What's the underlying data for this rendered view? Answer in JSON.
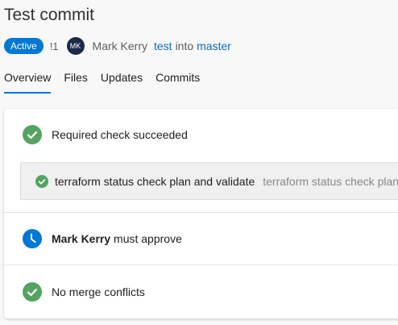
{
  "header": {
    "title": "Test commit",
    "status": "Active",
    "pr_id": "!1",
    "avatar_initials": "MK",
    "author": "Mark Kerry",
    "source_branch": "test",
    "into": "into",
    "target_branch": "master"
  },
  "tabs": [
    {
      "label": "Overview",
      "selected": true
    },
    {
      "label": "Files",
      "selected": false
    },
    {
      "label": "Updates",
      "selected": false
    },
    {
      "label": "Commits",
      "selected": false
    }
  ],
  "checks": {
    "required": {
      "label": "Required check succeeded",
      "icon": "success-check-icon",
      "item": {
        "name": "terraform status check plan and validate",
        "description": "terraform status check plan"
      }
    },
    "reviewer": {
      "name": "Mark Kerry",
      "suffix": "must approve",
      "icon": "clock-icon"
    },
    "merge": {
      "label": "No merge conflicts",
      "icon": "success-check-icon"
    }
  },
  "colors": {
    "accent": "#0078d4",
    "success": "#55a362",
    "link": "#0b6cbf"
  }
}
